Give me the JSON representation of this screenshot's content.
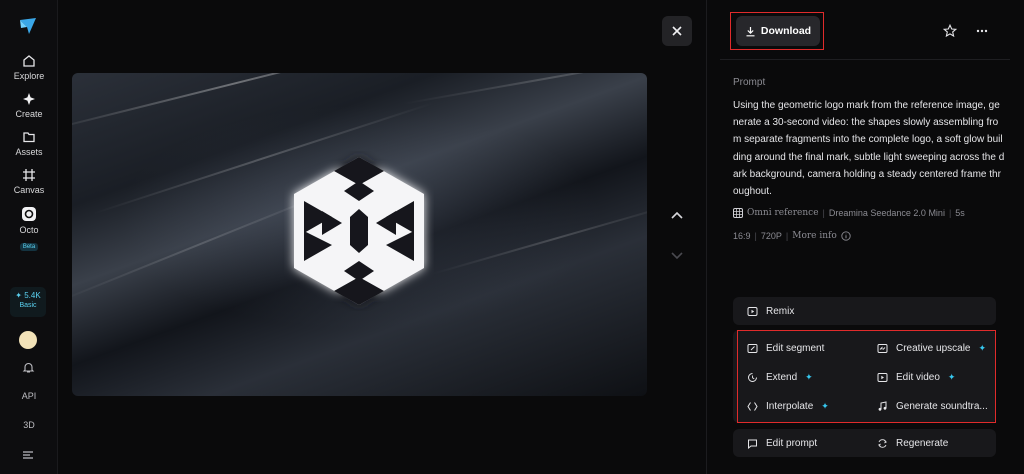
{
  "sidebar": {
    "items": [
      {
        "label": "Explore",
        "icon": "home-icon"
      },
      {
        "label": "Create",
        "icon": "sparkle-icon"
      },
      {
        "label": "Assets",
        "icon": "folder-icon"
      },
      {
        "label": "Canvas",
        "icon": "canvas-icon"
      },
      {
        "label": "Octo",
        "icon": "octo-icon",
        "badge": "Beta"
      }
    ],
    "credits": {
      "amount": "5.4K",
      "tier": "Basic"
    },
    "api_label": "API",
    "threed_label": "3D"
  },
  "toolbar": {
    "download_label": "Download"
  },
  "prompt": {
    "label": "Prompt",
    "text": "Using the geometric logo mark from the reference image, generate a 30-second video: the shapes slowly assembling from separate fragments into the complete logo, a soft glow building around the final mark, subtle light sweeping across the dark background, camera holding a steady centered frame throughout."
  },
  "meta": {
    "reference": "Omni reference",
    "model": "Dreamina Seedance 2.0 Mini",
    "duration": "5s",
    "ratio": "16:9",
    "resolution": "720P",
    "more_info": "More info"
  },
  "actions": {
    "remix": "Remix",
    "edit_segment": "Edit segment",
    "creative_upscale": "Creative upscale",
    "extend": "Extend",
    "edit_video": "Edit video",
    "interpolate": "Interpolate",
    "generate_soundtrack": "Generate soundtra...",
    "edit_prompt": "Edit prompt",
    "regenerate": "Regenerate"
  },
  "colors": {
    "accent": "#36c8f0",
    "highlight": "#e02b2b"
  }
}
